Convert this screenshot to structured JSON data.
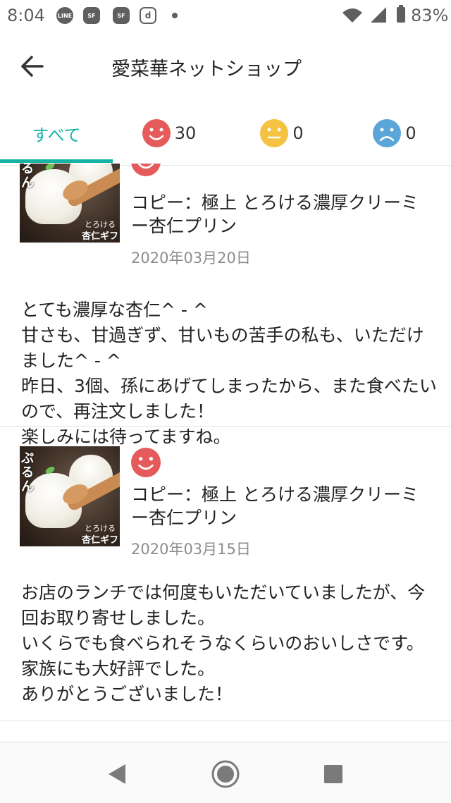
{
  "status_bar": {
    "time": "8:04",
    "notification_icons": [
      "line-icon",
      "sf-icon",
      "sf-icon",
      "d-icon"
    ],
    "battery": "83%"
  },
  "app_bar": {
    "title": "愛菜華ネットショップ",
    "back_icon": "arrow-left-icon"
  },
  "tabs": [
    {
      "label": "すべて",
      "active": true
    },
    {
      "label": "30",
      "icon": "smile-face-icon",
      "color": "#e55b5b"
    },
    {
      "label": "0",
      "icon": "neutral-face-icon",
      "color": "#f5c242"
    },
    {
      "label": "0",
      "icon": "sad-face-icon",
      "color": "#5aa6d9"
    }
  ],
  "reviews": [
    {
      "thumb_side_text": "ぷるん",
      "thumb_caption_1": "とろける",
      "thumb_caption_2": "杏仁ギフト",
      "product": "コピー：極上 とろける濃厚クリーミー杏仁プリン",
      "date": "2020年03月20日",
      "rating": "smile",
      "text": "とても濃厚な杏仁^ - ^\n甘さも、甘過ぎず、甘いもの苦手の私も、いただけました^ - ^\n昨日、3個、孫にあげてしまったから、また食べたいので、再注文しました！\n楽しみには待ってますね。"
    },
    {
      "thumb_side_text": "ぷるん",
      "thumb_caption_1": "とろける",
      "thumb_caption_2": "杏仁ギフト",
      "product": "コピー：極上 とろける濃厚クリーミー杏仁プリン",
      "date": "2020年03月15日",
      "rating": "smile",
      "text": "お店のランチでは何度もいただいていましたが、今回お取り寄せしました。\nいくらでも食べられそうなくらいのおいしさです。家族にも大好評でした。\nありがとうございました！"
    }
  ],
  "nav_bar": {
    "buttons": [
      "back-triangle-icon",
      "home-circle-icon",
      "recents-square-icon"
    ]
  }
}
